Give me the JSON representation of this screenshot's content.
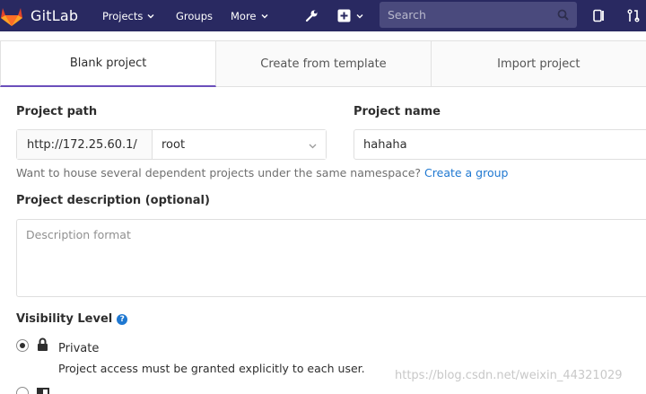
{
  "navbar": {
    "brand": "GitLab",
    "items": [
      "Projects",
      "Groups",
      "More"
    ],
    "search_placeholder": "Search",
    "colors": {
      "background": "#292961",
      "search": "#4a4a7d",
      "logo": "#e2432a"
    },
    "icons": [
      "gitlab-logo-icon",
      "wrench-icon",
      "plus-square-icon",
      "search-icon",
      "issues-icon",
      "merge-request-icon"
    ]
  },
  "tabs": [
    {
      "label": "Blank project",
      "active": true
    },
    {
      "label": "Create from template",
      "active": false
    },
    {
      "label": "Import project",
      "active": false
    }
  ],
  "form": {
    "path_label": "Project path",
    "path_prefix": "http://172.25.60.1/",
    "namespace": "root",
    "name_label": "Project name",
    "name_value": "hahaha",
    "help_text": "Want to house several dependent projects under the same namespace?",
    "help_link": "Create a group",
    "description_label": "Project description (optional)",
    "description_placeholder": "Description format",
    "visibility_label": "Visibility Level",
    "visibility_options": [
      {
        "title": "Private",
        "description": "Project access must be granted explicitly to each user.",
        "selected": true
      }
    ]
  },
  "watermark": "https://blog.csdn.net/weixin_44321029",
  "accent_color": "#6b4fbb",
  "link_color": "#1f78d1"
}
